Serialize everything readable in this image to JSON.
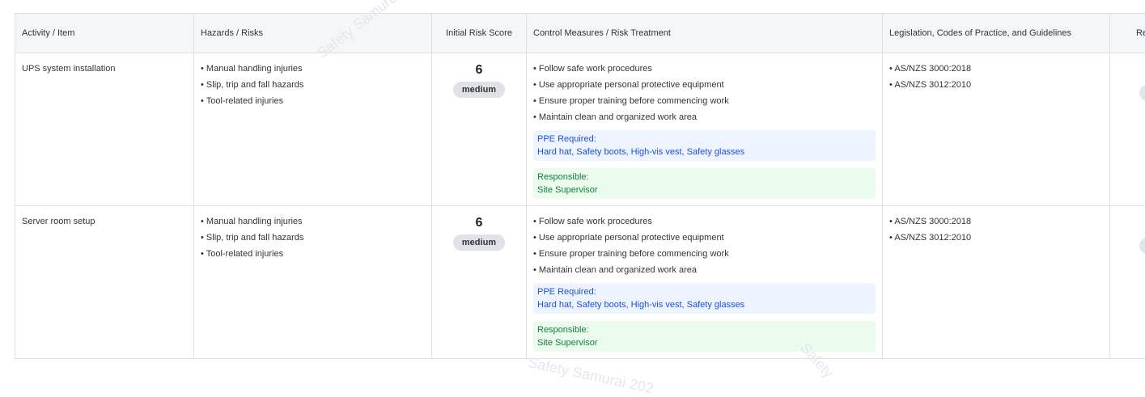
{
  "watermark": {
    "text1": "Safety Samurai",
    "text2": "Safety Samurai 202",
    "text3": "Safety"
  },
  "table": {
    "headers": [
      "Activity / Item",
      "Hazards / Risks",
      "Initial Risk Score",
      "Control Measures / Risk Treatment",
      "Legislation, Codes of Practice, and Guidelines",
      "Resi"
    ],
    "rows": [
      {
        "activity": "UPS system installation",
        "hazards": [
          "Manual handling injuries",
          "Slip, trip and fall hazards",
          "Tool-related injuries"
        ],
        "score": "6",
        "risk_level": "medium",
        "controls": [
          "Follow safe work procedures",
          "Use appropriate personal protective equipment",
          "Ensure proper training before commencing work",
          "Maintain clean and organized work area"
        ],
        "ppe_label": "PPE Required:",
        "ppe_value": "Hard hat, Safety boots, High-vis vest, Safety glasses",
        "responsible_label": "Responsible:",
        "responsible_value": "Site Supervisor",
        "legislation": [
          "AS/NZS 3000:2018",
          "AS/NZS 3012:2010"
        ]
      },
      {
        "activity": "Server room setup",
        "hazards": [
          "Manual handling injuries",
          "Slip, trip and fall hazards",
          "Tool-related injuries"
        ],
        "score": "6",
        "risk_level": "medium",
        "controls": [
          "Follow safe work procedures",
          "Use appropriate personal protective equipment",
          "Ensure proper training before commencing work",
          "Maintain clean and organized work area"
        ],
        "ppe_label": "PPE Required:",
        "ppe_value": "Hard hat, Safety boots, High-vis vest, Safety glasses",
        "responsible_label": "Responsible:",
        "responsible_value": "Site Supervisor",
        "legislation": [
          "AS/NZS 3000:2018",
          "AS/NZS 3012:2010"
        ]
      }
    ]
  }
}
